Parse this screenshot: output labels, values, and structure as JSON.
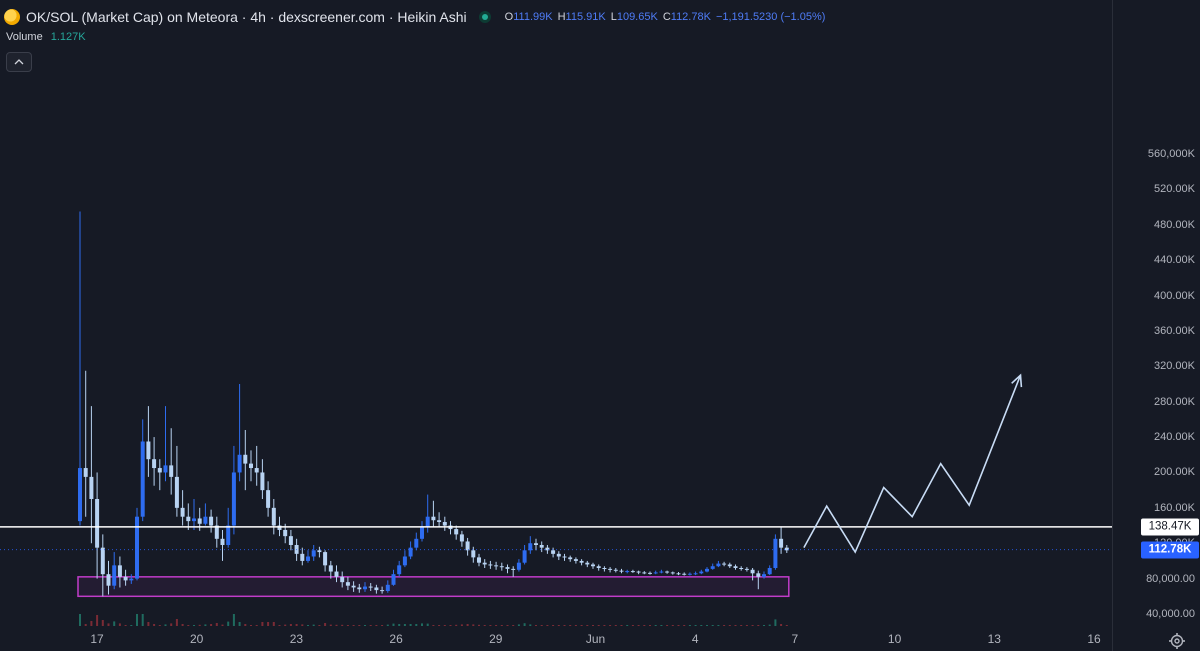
{
  "header": {
    "title": "OK/SOL (Market Cap) on Meteora · 4h · dexscreener.com · Heikin Ashi",
    "symbol_icon": "coin-icon",
    "status_icon": "market-open-dot-icon",
    "ohlc": {
      "open_label": "O",
      "open": "111.99K",
      "high_label": "H",
      "high": "115.91K",
      "low_label": "L",
      "low": "109.65K",
      "close_label": "C",
      "close": "112.78K",
      "change": "−1,191.5230 (−1.05%)"
    },
    "volume_label": "Volume",
    "volume_value": "1.127K"
  },
  "collapse_icon": "chevron-up-icon",
  "settings_icon": "gear-icon",
  "colors": {
    "background": "#161a25",
    "candle_up": "#2e6cf0",
    "candle_down": "#b8d3f2",
    "box_border": "#c13cc9",
    "resistance_line": "#ffffff",
    "projection": "#c8dcf5",
    "volume_up": "#1f6b5f",
    "volume_down": "#7a2b35"
  },
  "y_axis": {
    "ticks": [
      "560,000K",
      "520.00K",
      "480.00K",
      "440.00K",
      "400.00K",
      "360.00K",
      "320.00K",
      "280.00K",
      "240.00K",
      "200.00K",
      "160.00K",
      "120.00K",
      "80,000.00",
      "40,000.00"
    ],
    "resistance_tag": "138.47K",
    "last_price_tag": "112.78K"
  },
  "x_axis": {
    "ticks": [
      "17",
      "20",
      "23",
      "26",
      "29",
      "Jun",
      "4",
      "7",
      "10",
      "13",
      "16"
    ]
  },
  "chart_data": {
    "type": "candlestick",
    "style": "Heikin Ashi",
    "interval": "4h",
    "y_unit": "market cap",
    "ylim": [
      40000,
      560000
    ],
    "x": [
      "17",
      "20",
      "23",
      "26",
      "29",
      "Jun",
      "4",
      "7",
      "10",
      "13",
      "16"
    ],
    "series": [
      {
        "name": "OK/SOL (Market Cap)",
        "candles": [
          {
            "o": 145000,
            "c": 205000,
            "h": 495000,
            "l": 140000
          },
          {
            "o": 205000,
            "c": 195000,
            "h": 315000,
            "l": 150000
          },
          {
            "o": 195000,
            "c": 170000,
            "h": 275000,
            "l": 120000
          },
          {
            "o": 170000,
            "c": 115000,
            "h": 200000,
            "l": 80000
          },
          {
            "o": 115000,
            "c": 85000,
            "h": 130000,
            "l": 60000
          },
          {
            "o": 85000,
            "c": 72000,
            "h": 100000,
            "l": 62000
          },
          {
            "o": 72000,
            "c": 95000,
            "h": 110000,
            "l": 68000
          },
          {
            "o": 95000,
            "c": 82000,
            "h": 105000,
            "l": 70000
          },
          {
            "o": 82000,
            "c": 78000,
            "h": 90000,
            "l": 72000
          },
          {
            "o": 78000,
            "c": 80000,
            "h": 85000,
            "l": 74000
          },
          {
            "o": 80000,
            "c": 150000,
            "h": 160000,
            "l": 78000
          },
          {
            "o": 150000,
            "c": 235000,
            "h": 260000,
            "l": 145000
          },
          {
            "o": 235000,
            "c": 215000,
            "h": 275000,
            "l": 195000
          },
          {
            "o": 215000,
            "c": 205000,
            "h": 240000,
            "l": 185000
          },
          {
            "o": 205000,
            "c": 200000,
            "h": 215000,
            "l": 180000
          },
          {
            "o": 200000,
            "c": 208000,
            "h": 275000,
            "l": 190000
          },
          {
            "o": 208000,
            "c": 195000,
            "h": 250000,
            "l": 175000
          },
          {
            "o": 195000,
            "c": 160000,
            "h": 230000,
            "l": 150000
          },
          {
            "o": 160000,
            "c": 150000,
            "h": 180000,
            "l": 140000
          },
          {
            "o": 150000,
            "c": 145000,
            "h": 165000,
            "l": 135000
          },
          {
            "o": 145000,
            "c": 148000,
            "h": 170000,
            "l": 135000
          },
          {
            "o": 148000,
            "c": 142000,
            "h": 160000,
            "l": 134000
          },
          {
            "o": 142000,
            "c": 150000,
            "h": 165000,
            "l": 140000
          },
          {
            "o": 150000,
            "c": 140000,
            "h": 158000,
            "l": 132000
          },
          {
            "o": 140000,
            "c": 125000,
            "h": 150000,
            "l": 115000
          },
          {
            "o": 125000,
            "c": 118000,
            "h": 135000,
            "l": 100000
          },
          {
            "o": 118000,
            "c": 140000,
            "h": 160000,
            "l": 115000
          },
          {
            "o": 140000,
            "c": 200000,
            "h": 230000,
            "l": 130000
          },
          {
            "o": 200000,
            "c": 220000,
            "h": 300000,
            "l": 190000
          },
          {
            "o": 220000,
            "c": 210000,
            "h": 248000,
            "l": 180000
          },
          {
            "o": 210000,
            "c": 205000,
            "h": 225000,
            "l": 190000
          },
          {
            "o": 205000,
            "c": 200000,
            "h": 230000,
            "l": 185000
          },
          {
            "o": 200000,
            "c": 180000,
            "h": 215000,
            "l": 170000
          },
          {
            "o": 180000,
            "c": 160000,
            "h": 190000,
            "l": 150000
          },
          {
            "o": 160000,
            "c": 140000,
            "h": 170000,
            "l": 130000
          },
          {
            "o": 140000,
            "c": 135000,
            "h": 150000,
            "l": 128000
          },
          {
            "o": 135000,
            "c": 128000,
            "h": 142000,
            "l": 120000
          },
          {
            "o": 128000,
            "c": 118000,
            "h": 135000,
            "l": 112000
          },
          {
            "o": 118000,
            "c": 108000,
            "h": 125000,
            "l": 100000
          },
          {
            "o": 108000,
            "c": 100000,
            "h": 115000,
            "l": 95000
          },
          {
            "o": 100000,
            "c": 105000,
            "h": 112000,
            "l": 98000
          },
          {
            "o": 105000,
            "c": 112000,
            "h": 118000,
            "l": 100000
          },
          {
            "o": 112000,
            "c": 110000,
            "h": 116000,
            "l": 104000
          },
          {
            "o": 110000,
            "c": 95000,
            "h": 112000,
            "l": 88000
          },
          {
            "o": 95000,
            "c": 88000,
            "h": 100000,
            "l": 80000
          },
          {
            "o": 88000,
            "c": 82000,
            "h": 95000,
            "l": 76000
          },
          {
            "o": 82000,
            "c": 76000,
            "h": 88000,
            "l": 70000
          },
          {
            "o": 76000,
            "c": 72000,
            "h": 82000,
            "l": 67000
          },
          {
            "o": 72000,
            "c": 70000,
            "h": 77000,
            "l": 65000
          },
          {
            "o": 70000,
            "c": 68000,
            "h": 74000,
            "l": 64000
          },
          {
            "o": 68000,
            "c": 71000,
            "h": 76000,
            "l": 65000
          },
          {
            "o": 71000,
            "c": 70000,
            "h": 75000,
            "l": 66000
          },
          {
            "o": 70000,
            "c": 67000,
            "h": 73000,
            "l": 63000
          },
          {
            "o": 67000,
            "c": 66000,
            "h": 71000,
            "l": 63000
          },
          {
            "o": 66000,
            "c": 73000,
            "h": 78000,
            "l": 64000
          },
          {
            "o": 73000,
            "c": 85000,
            "h": 90000,
            "l": 72000
          },
          {
            "o": 85000,
            "c": 95000,
            "h": 100000,
            "l": 82000
          },
          {
            "o": 95000,
            "c": 105000,
            "h": 112000,
            "l": 93000
          },
          {
            "o": 105000,
            "c": 115000,
            "h": 122000,
            "l": 102000
          },
          {
            "o": 115000,
            "c": 125000,
            "h": 132000,
            "l": 112000
          },
          {
            "o": 125000,
            "c": 138000,
            "h": 145000,
            "l": 122000
          },
          {
            "o": 138000,
            "c": 150000,
            "h": 175000,
            "l": 132000
          },
          {
            "o": 150000,
            "c": 146000,
            "h": 168000,
            "l": 138000
          },
          {
            "o": 146000,
            "c": 144000,
            "h": 155000,
            "l": 138000
          },
          {
            "o": 144000,
            "c": 140000,
            "h": 150000,
            "l": 134000
          },
          {
            "o": 140000,
            "c": 136000,
            "h": 145000,
            "l": 130000
          },
          {
            "o": 136000,
            "c": 130000,
            "h": 140000,
            "l": 124000
          },
          {
            "o": 130000,
            "c": 122000,
            "h": 134000,
            "l": 116000
          },
          {
            "o": 122000,
            "c": 112000,
            "h": 126000,
            "l": 106000
          },
          {
            "o": 112000,
            "c": 104000,
            "h": 116000,
            "l": 98000
          },
          {
            "o": 104000,
            "c": 98000,
            "h": 108000,
            "l": 94000
          },
          {
            "o": 98000,
            "c": 96000,
            "h": 102000,
            "l": 92000
          },
          {
            "o": 96000,
            "c": 95000,
            "h": 100000,
            "l": 91000
          },
          {
            "o": 95000,
            "c": 94000,
            "h": 99000,
            "l": 90000
          },
          {
            "o": 94000,
            "c": 93000,
            "h": 98000,
            "l": 89000
          },
          {
            "o": 93000,
            "c": 91000,
            "h": 96000,
            "l": 86000
          },
          {
            "o": 91000,
            "c": 90000,
            "h": 94000,
            "l": 82000
          },
          {
            "o": 90000,
            "c": 98000,
            "h": 102000,
            "l": 88000
          },
          {
            "o": 98000,
            "c": 112000,
            "h": 118000,
            "l": 96000
          },
          {
            "o": 112000,
            "c": 120000,
            "h": 128000,
            "l": 108000
          },
          {
            "o": 120000,
            "c": 118000,
            "h": 125000,
            "l": 112000
          },
          {
            "o": 118000,
            "c": 115000,
            "h": 122000,
            "l": 110000
          },
          {
            "o": 115000,
            "c": 112000,
            "h": 118000,
            "l": 108000
          },
          {
            "o": 112000,
            "c": 108000,
            "h": 115000,
            "l": 104000
          },
          {
            "o": 108000,
            "c": 105000,
            "h": 111000,
            "l": 101000
          },
          {
            "o": 105000,
            "c": 104000,
            "h": 108000,
            "l": 100000
          },
          {
            "o": 104000,
            "c": 102000,
            "h": 106000,
            "l": 99000
          },
          {
            "o": 102000,
            "c": 100000,
            "h": 104000,
            "l": 97000
          },
          {
            "o": 100000,
            "c": 98000,
            "h": 102000,
            "l": 95000
          },
          {
            "o": 98000,
            "c": 96000,
            "h": 100000,
            "l": 93000
          },
          {
            "o": 96000,
            "c": 94000,
            "h": 98000,
            "l": 91000
          },
          {
            "o": 94000,
            "c": 92000,
            "h": 96000,
            "l": 89000
          },
          {
            "o": 92000,
            "c": 91000,
            "h": 94000,
            "l": 88000
          },
          {
            "o": 91000,
            "c": 90000,
            "h": 93000,
            "l": 87000
          },
          {
            "o": 90000,
            "c": 89000,
            "h": 92000,
            "l": 87000
          },
          {
            "o": 89000,
            "c": 88000,
            "h": 91000,
            "l": 86000
          },
          {
            "o": 88000,
            "c": 88500,
            "h": 90000,
            "l": 86000
          },
          {
            "o": 88500,
            "c": 88000,
            "h": 90000,
            "l": 86500
          },
          {
            "o": 88000,
            "c": 87000,
            "h": 89000,
            "l": 85000
          },
          {
            "o": 87000,
            "c": 86500,
            "h": 88500,
            "l": 85000
          },
          {
            "o": 86500,
            "c": 86000,
            "h": 88000,
            "l": 84500
          },
          {
            "o": 86000,
            "c": 87000,
            "h": 89000,
            "l": 85000
          },
          {
            "o": 87000,
            "c": 88000,
            "h": 90000,
            "l": 86000
          },
          {
            "o": 88000,
            "c": 87000,
            "h": 89000,
            "l": 85500
          },
          {
            "o": 87000,
            "c": 86000,
            "h": 88000,
            "l": 84500
          },
          {
            "o": 86000,
            "c": 85500,
            "h": 87500,
            "l": 84000
          },
          {
            "o": 85500,
            "c": 85000,
            "h": 87000,
            "l": 83500
          },
          {
            "o": 85000,
            "c": 85500,
            "h": 87000,
            "l": 83500
          },
          {
            "o": 85500,
            "c": 86000,
            "h": 88000,
            "l": 84000
          },
          {
            "o": 86000,
            "c": 88000,
            "h": 90000,
            "l": 85000
          },
          {
            "o": 88000,
            "c": 91000,
            "h": 93000,
            "l": 87000
          },
          {
            "o": 91000,
            "c": 94000,
            "h": 97000,
            "l": 90000
          },
          {
            "o": 94000,
            "c": 97000,
            "h": 100000,
            "l": 93000
          },
          {
            "o": 97000,
            "c": 96000,
            "h": 99000,
            "l": 94000
          },
          {
            "o": 96000,
            "c": 94000,
            "h": 98000,
            "l": 92000
          },
          {
            "o": 94000,
            "c": 92000,
            "h": 96000,
            "l": 90000
          },
          {
            "o": 92000,
            "c": 91000,
            "h": 94000,
            "l": 89000
          },
          {
            "o": 91000,
            "c": 90000,
            "h": 93000,
            "l": 88000
          },
          {
            "o": 90000,
            "c": 86000,
            "h": 92000,
            "l": 78000
          },
          {
            "o": 86000,
            "c": 82000,
            "h": 89000,
            "l": 68000
          },
          {
            "o": 82000,
            "c": 85000,
            "h": 88000,
            "l": 80000
          },
          {
            "o": 85000,
            "c": 92000,
            "h": 95000,
            "l": 84000
          },
          {
            "o": 92000,
            "c": 125000,
            "h": 130000,
            "l": 90000
          },
          {
            "o": 125000,
            "c": 115000,
            "h": 138000,
            "l": 108000
          },
          {
            "o": 115000,
            "c": 112000,
            "h": 118000,
            "l": 109000
          }
        ]
      }
    ],
    "volume": "bars along bottom of pane, concentrated at start of period",
    "annotations": [
      {
        "type": "horizontal_line",
        "value": 138470,
        "label": "138.47K"
      },
      {
        "type": "rectangle",
        "from_candle": 0,
        "to_candle": 124,
        "y_low": 60000,
        "y_high": 82000
      },
      {
        "type": "polyline",
        "points": [
          {
            "candle": 127,
            "value": 115000
          },
          {
            "candle": 131,
            "value": 162000
          },
          {
            "candle": 136,
            "value": 110000
          },
          {
            "candle": 141,
            "value": 183000
          },
          {
            "candle": 146,
            "value": 150000
          },
          {
            "candle": 151,
            "value": 210000
          },
          {
            "candle": 156,
            "value": 163000
          },
          {
            "candle": 165,
            "value": 310000
          }
        ],
        "arrow_end": true
      }
    ],
    "last_price": 112780,
    "grid": false
  }
}
